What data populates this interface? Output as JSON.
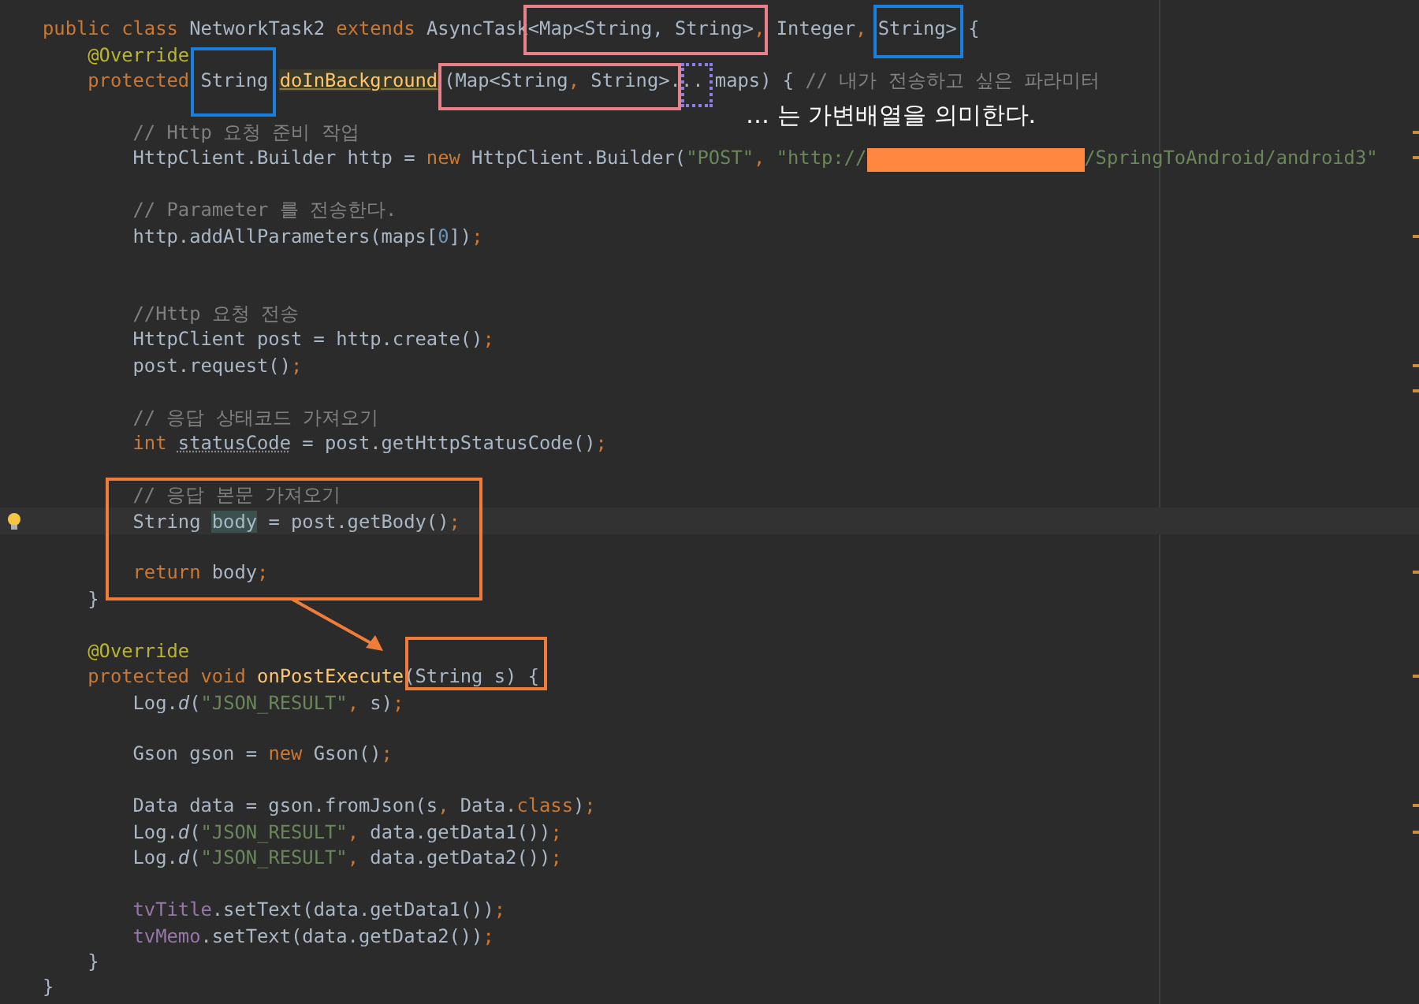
{
  "editor": {
    "lines": [
      {
        "kind": "code",
        "tokens": [
          {
            "kind": "kw",
            "text": "public class "
          },
          {
            "kind": "plain",
            "text": "NetworkTask2 "
          },
          {
            "kind": "kw",
            "text": "extends "
          },
          {
            "kind": "plain",
            "text": "AsyncTask"
          },
          {
            "kind": "plain",
            "text": "<Map<String, String>"
          },
          {
            "kind": "kw",
            "text": ", "
          },
          {
            "kind": "plain",
            "text": "Integer"
          },
          {
            "kind": "kw",
            "text": ", "
          },
          {
            "kind": "plain",
            "text": "String>"
          },
          {
            "kind": "plain",
            "text": " {"
          }
        ]
      },
      {
        "kind": "code",
        "tokens": [
          {
            "kind": "annot",
            "text": "    @Override"
          }
        ]
      },
      {
        "kind": "code",
        "tokens": [
          {
            "kind": "kw",
            "text": "    protected "
          },
          {
            "kind": "plain",
            "text": "String "
          },
          {
            "kind": "decl_hl",
            "text": "doInBackground"
          },
          {
            "kind": "plain",
            "text": "(Map<String"
          },
          {
            "kind": "kw",
            "text": ", "
          },
          {
            "kind": "plain",
            "text": "String>"
          },
          {
            "kind": "plain",
            "text": "... maps) { "
          },
          {
            "kind": "comment",
            "text": "// 내가 전송하고 싶은 파라미터"
          }
        ]
      },
      {
        "kind": "blank"
      },
      {
        "kind": "code",
        "tokens": [
          {
            "kind": "comment",
            "text": "        // Http 요청 준비 작업"
          }
        ],
        "marker": true
      },
      {
        "kind": "code",
        "tokens": [
          {
            "kind": "plain",
            "text": "        HttpClient.Builder http = "
          },
          {
            "kind": "kw",
            "text": "new "
          },
          {
            "kind": "plain",
            "text": "HttpClient.Builder("
          },
          {
            "kind": "str",
            "text": "\"POST\""
          },
          {
            "kind": "kw",
            "text": ", "
          },
          {
            "kind": "str",
            "text": "\"http://"
          },
          {
            "kind": "redacted"
          },
          {
            "kind": "str",
            "text": "/SpringToAndroid/android3\""
          }
        ],
        "marker": true
      },
      {
        "kind": "blank"
      },
      {
        "kind": "code",
        "tokens": [
          {
            "kind": "comment",
            "text": "        // Parameter 를 전송한다."
          }
        ]
      },
      {
        "kind": "code",
        "tokens": [
          {
            "kind": "plain",
            "text": "        http.addAllParameters(maps["
          },
          {
            "kind": "num",
            "text": "0"
          },
          {
            "kind": "plain",
            "text": "])"
          },
          {
            "kind": "kw",
            "text": ";"
          }
        ],
        "marker": true
      },
      {
        "kind": "blank"
      },
      {
        "kind": "blank"
      },
      {
        "kind": "code",
        "tokens": [
          {
            "kind": "comment",
            "text": "        //Http 요청 전송"
          }
        ]
      },
      {
        "kind": "code",
        "tokens": [
          {
            "kind": "plain",
            "text": "        HttpClient post = http.create()"
          },
          {
            "kind": "kw",
            "text": ";"
          }
        ]
      },
      {
        "kind": "code",
        "tokens": [
          {
            "kind": "plain",
            "text": "        post.request()"
          },
          {
            "kind": "kw",
            "text": ";"
          }
        ],
        "marker": true
      },
      {
        "kind": "blank",
        "marker": true
      },
      {
        "kind": "code",
        "tokens": [
          {
            "kind": "comment",
            "text": "        // 응답 상태코드 가져오기"
          }
        ]
      },
      {
        "kind": "code",
        "tokens": [
          {
            "kind": "kw",
            "text": "        int "
          },
          {
            "kind": "unused",
            "text": "statusCode"
          },
          {
            "kind": "plain",
            "text": " = post.getHttpStatusCode()"
          },
          {
            "kind": "kw",
            "text": ";"
          }
        ]
      },
      {
        "kind": "blank"
      },
      {
        "kind": "code",
        "tokens": [
          {
            "kind": "comment",
            "text": "        // 응답 본문 가져오기"
          }
        ]
      },
      {
        "kind": "code",
        "tokens": [
          {
            "kind": "plain",
            "text": "        String "
          },
          {
            "kind": "usage_hl",
            "text": "body"
          },
          {
            "kind": "plain",
            "text": " = post.getBody()"
          },
          {
            "kind": "kw",
            "text": ";"
          }
        ],
        "current": true
      },
      {
        "kind": "blank"
      },
      {
        "kind": "code",
        "tokens": [
          {
            "kind": "kw",
            "text": "        return "
          },
          {
            "kind": "plain",
            "text": "body"
          },
          {
            "kind": "kw",
            "text": ";"
          }
        ],
        "marker": true
      },
      {
        "kind": "code",
        "tokens": [
          {
            "kind": "plain",
            "text": "    }"
          }
        ]
      },
      {
        "kind": "blank"
      },
      {
        "kind": "code",
        "tokens": [
          {
            "kind": "annot",
            "text": "    @Override"
          }
        ]
      },
      {
        "kind": "code",
        "tokens": [
          {
            "kind": "kw",
            "text": "    protected void "
          },
          {
            "kind": "decl",
            "text": "onPostExecute"
          },
          {
            "kind": "plain",
            "text": "(String s) {"
          }
        ],
        "marker": true
      },
      {
        "kind": "code",
        "tokens": [
          {
            "kind": "plain",
            "text": "        Log."
          },
          {
            "kind": "static",
            "text": "d"
          },
          {
            "kind": "plain",
            "text": "("
          },
          {
            "kind": "str",
            "text": "\"JSON_RESULT\""
          },
          {
            "kind": "kw",
            "text": ", "
          },
          {
            "kind": "plain",
            "text": "s)"
          },
          {
            "kind": "kw",
            "text": ";"
          }
        ]
      },
      {
        "kind": "blank"
      },
      {
        "kind": "code",
        "tokens": [
          {
            "kind": "plain",
            "text": "        Gson gson = "
          },
          {
            "kind": "kw",
            "text": "new "
          },
          {
            "kind": "plain",
            "text": "Gson()"
          },
          {
            "kind": "kw",
            "text": ";"
          }
        ]
      },
      {
        "kind": "blank"
      },
      {
        "kind": "code",
        "tokens": [
          {
            "kind": "plain",
            "text": "        Data data = gson.fromJson(s"
          },
          {
            "kind": "kw",
            "text": ", "
          },
          {
            "kind": "plain",
            "text": "Data."
          },
          {
            "kind": "kw",
            "text": "class"
          },
          {
            "kind": "plain",
            "text": ")"
          },
          {
            "kind": "kw",
            "text": ";"
          }
        ],
        "marker": true
      },
      {
        "kind": "code",
        "tokens": [
          {
            "kind": "plain",
            "text": "        Log."
          },
          {
            "kind": "static",
            "text": "d"
          },
          {
            "kind": "plain",
            "text": "("
          },
          {
            "kind": "str",
            "text": "\"JSON_RESULT\""
          },
          {
            "kind": "kw",
            "text": ", "
          },
          {
            "kind": "plain",
            "text": "data.getData1())"
          },
          {
            "kind": "kw",
            "text": ";"
          }
        ],
        "marker": true
      },
      {
        "kind": "code",
        "tokens": [
          {
            "kind": "plain",
            "text": "        Log."
          },
          {
            "kind": "static",
            "text": "d"
          },
          {
            "kind": "plain",
            "text": "("
          },
          {
            "kind": "str",
            "text": "\"JSON_RESULT\""
          },
          {
            "kind": "kw",
            "text": ", "
          },
          {
            "kind": "plain",
            "text": "data.getData2())"
          },
          {
            "kind": "kw",
            "text": ";"
          }
        ]
      },
      {
        "kind": "blank"
      },
      {
        "kind": "code",
        "tokens": [
          {
            "kind": "field",
            "text": "        tvTitle"
          },
          {
            "kind": "plain",
            "text": ".setText(data.getData1())"
          },
          {
            "kind": "kw",
            "text": ";"
          }
        ]
      },
      {
        "kind": "code",
        "tokens": [
          {
            "kind": "field",
            "text": "        tvMemo"
          },
          {
            "kind": "plain",
            "text": ".setText(data.getData2())"
          },
          {
            "kind": "kw",
            "text": ";"
          }
        ]
      },
      {
        "kind": "code",
        "tokens": [
          {
            "kind": "plain",
            "text": "    }"
          }
        ]
      },
      {
        "kind": "code",
        "tokens": [
          {
            "kind": "plain",
            "text": "}"
          }
        ]
      }
    ]
  },
  "annotations": {
    "note": "… 는 가변배열을 의미한다.",
    "boxes": [
      {
        "kind": "solid",
        "color": "#e8828a"
      },
      {
        "kind": "solid",
        "color": "#1b7fe0"
      },
      {
        "kind": "solid",
        "color": "#1b7fe0"
      },
      {
        "kind": "solid",
        "color": "#e8828a"
      },
      {
        "kind": "dotted",
        "color": "#8a7fe8"
      },
      {
        "kind": "solid",
        "color": "#f07c3a"
      },
      {
        "kind": "solid",
        "color": "#f07c3a"
      }
    ]
  }
}
